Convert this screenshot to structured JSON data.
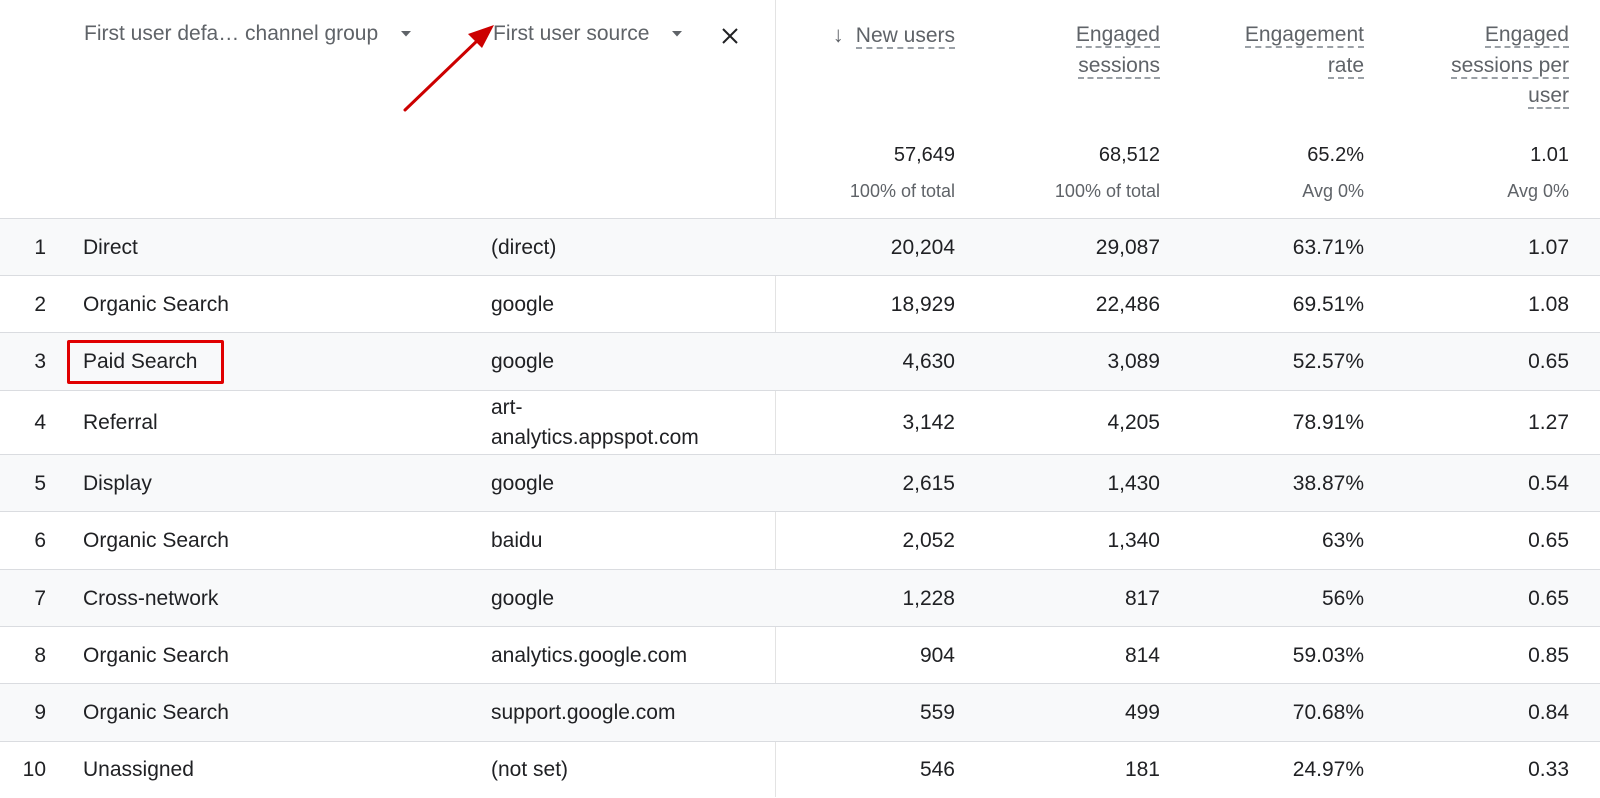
{
  "dimensions": {
    "primary_label": "First user defa… channel group",
    "secondary_label": "First user source"
  },
  "metrics": [
    {
      "label_lines": [
        "New users"
      ],
      "sorted": true,
      "total": "57,649",
      "total_sub": "100% of total"
    },
    {
      "label_lines": [
        "Engaged",
        "sessions"
      ],
      "sorted": false,
      "total": "68,512",
      "total_sub": "100% of total"
    },
    {
      "label_lines": [
        "Engagement",
        "rate"
      ],
      "sorted": false,
      "total": "65.2%",
      "total_sub": "Avg 0%"
    },
    {
      "label_lines": [
        "Engaged",
        "sessions per",
        "user"
      ],
      "sorted": false,
      "total": "1.01",
      "total_sub": "Avg 0%"
    }
  ],
  "rows": [
    {
      "index": "1",
      "channel": "Direct",
      "source": "(direct)",
      "values": [
        "20,204",
        "29,087",
        "63.71%",
        "1.07"
      ]
    },
    {
      "index": "2",
      "channel": "Organic Search",
      "source": "google",
      "values": [
        "18,929",
        "22,486",
        "69.51%",
        "1.08"
      ]
    },
    {
      "index": "3",
      "channel": "Paid Search",
      "source": "google",
      "values": [
        "4,630",
        "3,089",
        "52.57%",
        "0.65"
      ]
    },
    {
      "index": "4",
      "channel": "Referral",
      "source": "art-analytics.appspot.com",
      "source_lines": [
        "art-",
        "analytics.appspot.com"
      ],
      "values": [
        "3,142",
        "4,205",
        "78.91%",
        "1.27"
      ]
    },
    {
      "index": "5",
      "channel": "Display",
      "source": "google",
      "values": [
        "2,615",
        "1,430",
        "38.87%",
        "0.54"
      ]
    },
    {
      "index": "6",
      "channel": "Organic Search",
      "source": "baidu",
      "values": [
        "2,052",
        "1,340",
        "63%",
        "0.65"
      ]
    },
    {
      "index": "7",
      "channel": "Cross-network",
      "source": "google",
      "values": [
        "1,228",
        "817",
        "56%",
        "0.65"
      ]
    },
    {
      "index": "8",
      "channel": "Organic Search",
      "source": "analytics.google.com",
      "values": [
        "904",
        "814",
        "59.03%",
        "0.85"
      ]
    },
    {
      "index": "9",
      "channel": "Organic Search",
      "source": "support.google.com",
      "values": [
        "559",
        "499",
        "70.68%",
        "0.84"
      ]
    },
    {
      "index": "10",
      "channel": "Unassigned",
      "source": "(not set)",
      "values": [
        "546",
        "181",
        "24.97%",
        "0.33"
      ]
    }
  ],
  "annotations": {
    "highlighted_row_index": "3",
    "highlight_color": "#e00000",
    "arrow_color": "#cc0000",
    "arrow_target": "First user source"
  },
  "colors": {
    "row_alt_bg": "#f8f9fa",
    "border": "#dadce0",
    "muted_text": "#5f6368"
  }
}
